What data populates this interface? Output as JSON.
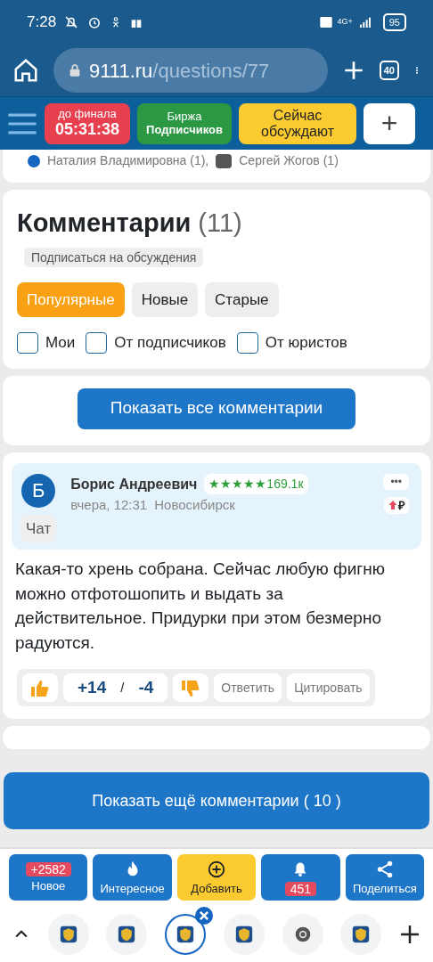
{
  "status_bar": {
    "time": "7:28",
    "network": "4G+",
    "battery": "95"
  },
  "browser": {
    "url_host": "9111.ru",
    "url_path": "/questions/77",
    "tab_count": "40"
  },
  "site_header": {
    "buttons": [
      {
        "kind": "timer",
        "label": "до финала",
        "value": "05:31:38"
      },
      {
        "kind": "green",
        "label": "Биржа",
        "value": "Подписчиков"
      },
      {
        "kind": "yellow",
        "label": "Сейчас",
        "value": "обсуждают"
      },
      {
        "kind": "plus",
        "label": "+"
      }
    ]
  },
  "participants": [
    "Наталия Владимировна (1),",
    "Сергей Жогов (1)"
  ],
  "comments_section": {
    "title": "Комментарии",
    "count": "(11)",
    "subscribe": "Подписаться на обсуждения",
    "sort_tabs": [
      {
        "label": "Популярные",
        "selected": true
      },
      {
        "label": "Новые",
        "selected": false
      },
      {
        "label": "Старые",
        "selected": false
      }
    ],
    "filters": [
      {
        "label": "Мои",
        "checked": false
      },
      {
        "label": "От подписчиков",
        "checked": false
      },
      {
        "label": "От юристов",
        "checked": false
      }
    ]
  },
  "show_all_button": "Показать все комментарии",
  "comment": {
    "avatar_letter": "Б",
    "author": "Борис Андреевич",
    "stars": 5,
    "rating": "169.1к",
    "time": "вчера, 12:31",
    "city": "Новосибирск",
    "chat": "Чат",
    "more": "•••",
    "currency": "₽",
    "text": "Какая-то хрень собрана. Сейчас любую фигню можно отфотошопить и выдать за действительное. Придурки при этом безмерно радуются.",
    "likes": "+14",
    "separator": "/",
    "dislikes": "-4",
    "actions": [
      "Ответить",
      "Цитировать"
    ]
  },
  "show_more_button": "Показать ещё комментарии ( 10 )",
  "bottom_bar": [
    {
      "kind": "new",
      "badge": "+2582",
      "label": "Новое"
    },
    {
      "kind": "fire",
      "label": "Интересное"
    },
    {
      "kind": "add",
      "label": "Добавить"
    },
    {
      "kind": "bell",
      "badge": "451"
    },
    {
      "kind": "share",
      "label": "Поделиться"
    }
  ],
  "tab_strip": [
    {
      "kind": "site",
      "selected": false
    },
    {
      "kind": "site",
      "selected": false
    },
    {
      "kind": "site",
      "selected": true
    },
    {
      "kind": "site",
      "selected": false
    },
    {
      "kind": "chrome",
      "selected": false
    },
    {
      "kind": "site",
      "selected": false
    }
  ]
}
